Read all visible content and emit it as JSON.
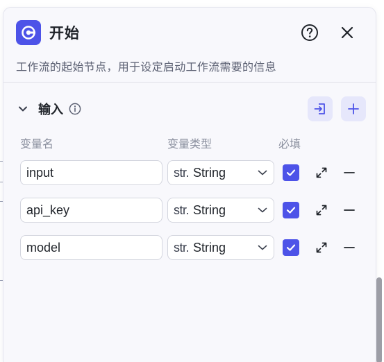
{
  "node": {
    "title": "开始",
    "description": "工作流的起始节点，用于设定启动工作流需要的信息",
    "logo_icon": "start-node-icon",
    "accent_color": "#4d53e8"
  },
  "header_actions": {
    "help_icon": "question-circle-icon",
    "close_icon": "close-icon"
  },
  "input_section": {
    "title": "输入",
    "columns": {
      "name": "变量名",
      "type": "变量类型",
      "required": "必填"
    },
    "rows": [
      {
        "name": "input",
        "type_icon": "str.",
        "type": "String",
        "required": true
      },
      {
        "name": "api_key",
        "type_icon": "str.",
        "type": "String",
        "required": true
      },
      {
        "name": "model",
        "type_icon": "str.",
        "type": "String",
        "required": true
      }
    ]
  }
}
